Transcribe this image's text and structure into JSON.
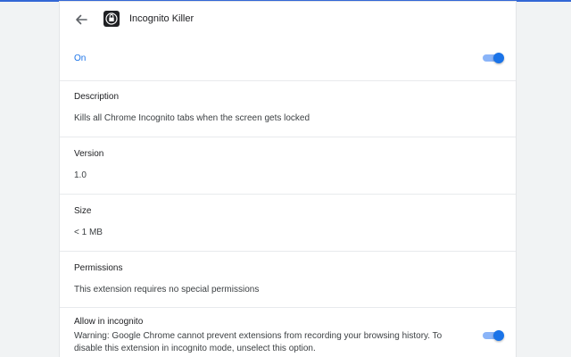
{
  "extension": {
    "name": "Incognito Killer",
    "enabled_label": "On",
    "enabled": true
  },
  "icons": {
    "back": "arrow-back-icon",
    "logo": "incognito-killer-logo-icon"
  },
  "colors": {
    "accent": "#1a73e8",
    "toggle_track": "#8ab4f8",
    "top_bar": "#3367d6"
  },
  "sections": {
    "description": {
      "title": "Description",
      "text": "Kills all Chrome Incognito tabs when the screen gets locked"
    },
    "version": {
      "title": "Version",
      "text": "1.0"
    },
    "size": {
      "title": "Size",
      "text": "< 1 MB"
    },
    "permissions": {
      "title": "Permissions",
      "text": "This extension requires no special permissions"
    },
    "incognito": {
      "title": "Allow in incognito",
      "warning": "Warning: Google Chrome cannot prevent extensions from recording your browsing history. To disable this extension in incognito mode, unselect this option.",
      "enabled": true
    }
  }
}
